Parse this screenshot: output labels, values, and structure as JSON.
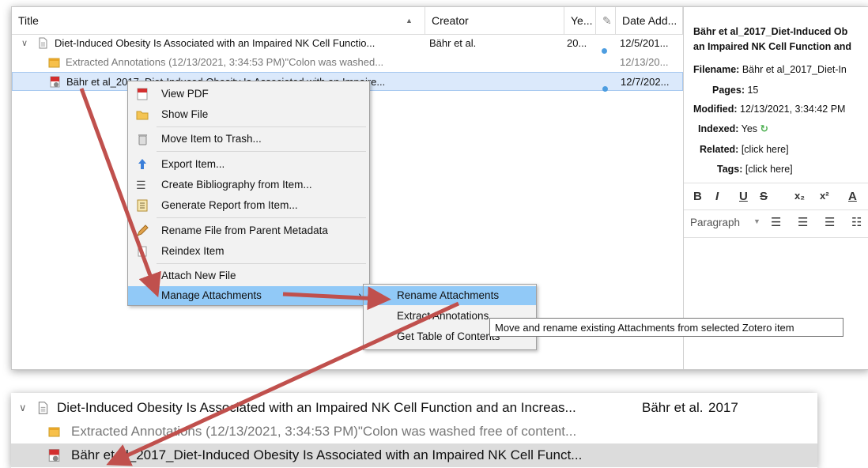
{
  "columns": {
    "title": "Title",
    "creator": "Creator",
    "year": "Ye...",
    "date_added": "Date Add..."
  },
  "rows": [
    {
      "title": "Diet-Induced Obesity Is Associated with an Impaired NK Cell Functio...",
      "creator": "Bähr et al.",
      "year": "20...",
      "date": "12/5/201..."
    },
    {
      "title": "Extracted Annotations (12/13/2021, 3:34:53 PM)\"Colon was washed...",
      "date": "12/13/20..."
    },
    {
      "title": "Bähr et al_2017_Diet-Induced Obesity Is Associated with an Impaire...",
      "date": "12/7/202..."
    }
  ],
  "item_pane": {
    "title_line1": "Bähr et al_2017_Diet-Induced Ob",
    "title_line2": "an Impaired NK Cell Function and",
    "filename_label": "Filename:",
    "filename_value": "Bähr et al_2017_Diet-In",
    "pages_label": "Pages:",
    "pages_value": "15",
    "modified_label": "Modified:",
    "modified_value": "12/13/2021, 3:34:42 PM",
    "indexed_label": "Indexed:",
    "indexed_value": "Yes",
    "related_label": "Related:",
    "related_value": "[click here]",
    "tags_label": "Tags:",
    "tags_value": "[click here]",
    "paragraph": "Paragraph"
  },
  "context_menu": {
    "view_pdf": "View PDF",
    "show_file": "Show File",
    "move_trash": "Move Item to Trash...",
    "export": "Export Item...",
    "bibliography": "Create Bibliography from Item...",
    "report": "Generate Report from Item...",
    "rename": "Rename File from Parent Metadata",
    "reindex": "Reindex Item",
    "attach": "Attach New File",
    "manage": "Manage Attachments"
  },
  "submenu": {
    "rename": "Rename Attachments",
    "extract": "Extract Annotations",
    "toc": "Get Table of Contents"
  },
  "tooltip": "Move and rename existing Attachments from selected Zotero item",
  "after": {
    "parent_title": "Diet-Induced Obesity Is Associated with an Impaired NK Cell Function and an Increas...",
    "parent_creator": "Bähr et al.",
    "parent_year": "2017",
    "note_title": "Extracted Annotations (12/13/2021, 3:34:53 PM)\"Colon was washed free of content...",
    "attachment_title": "Bähr et al_2017_Diet-Induced Obesity Is Associated with an Impaired NK Cell Funct..."
  },
  "colors": {
    "arrow": "#c0504d",
    "selection": "#dbe9fb",
    "menu_highlight": "#91c9f7"
  }
}
